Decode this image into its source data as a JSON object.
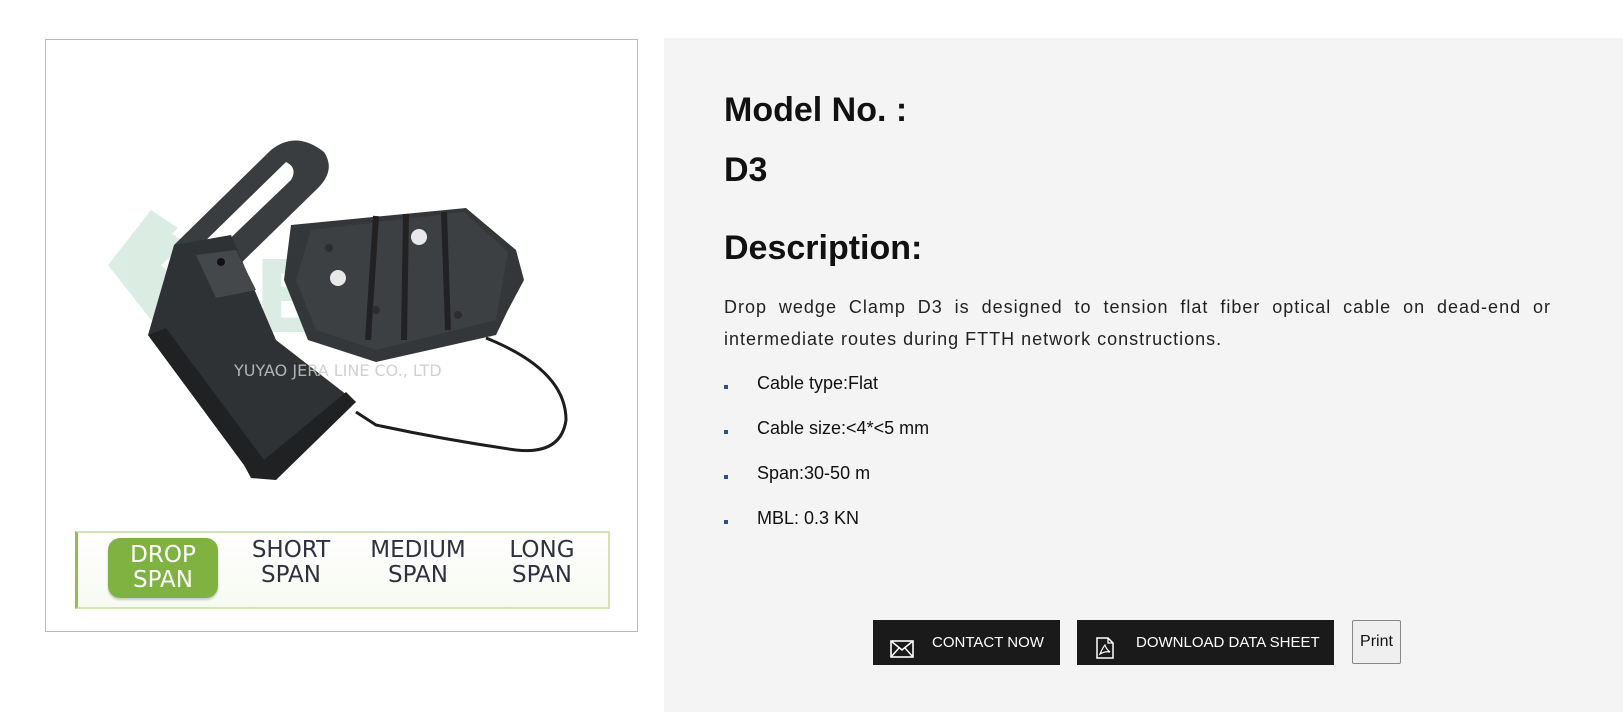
{
  "product_image": {
    "watermark_text": "YUYAO JERA LINE  CO., LTD",
    "logo_text": "JERA",
    "span_options": [
      {
        "line1": "DROP",
        "line2": "SPAN",
        "active": true
      },
      {
        "line1": "SHORT",
        "line2": "SPAN",
        "active": false
      },
      {
        "line1": "MEDIUM",
        "line2": "SPAN",
        "active": false
      },
      {
        "line1": "LONG",
        "line2": "SPAN",
        "active": false
      }
    ]
  },
  "details": {
    "model_label": "Model No. :",
    "model_value": "D3",
    "description_heading": "Description:",
    "description_text": "Drop wedge Clamp D3 is designed to tension flat fiber optical cable on dead-end or intermediate routes during FTTH network constructions.",
    "specs": [
      "Cable type:Flat",
      "Cable size:<4*<5 mm",
      "Span:30-50 m",
      "MBL: 0.3 KN"
    ]
  },
  "actions": {
    "contact_label": "CONTACT NOW",
    "contact_icon": "envelope-icon",
    "download_label": "DOWNLOAD DATA SHEET",
    "download_icon": "pdf-document-icon",
    "print_label": "Print"
  },
  "colors": {
    "span_active": "#7fb241",
    "panel_bg": "#f4f4f4",
    "button_dark": "#1a1a1a",
    "bullet": "#2a4f8f",
    "watermark": "#d8ece0"
  }
}
